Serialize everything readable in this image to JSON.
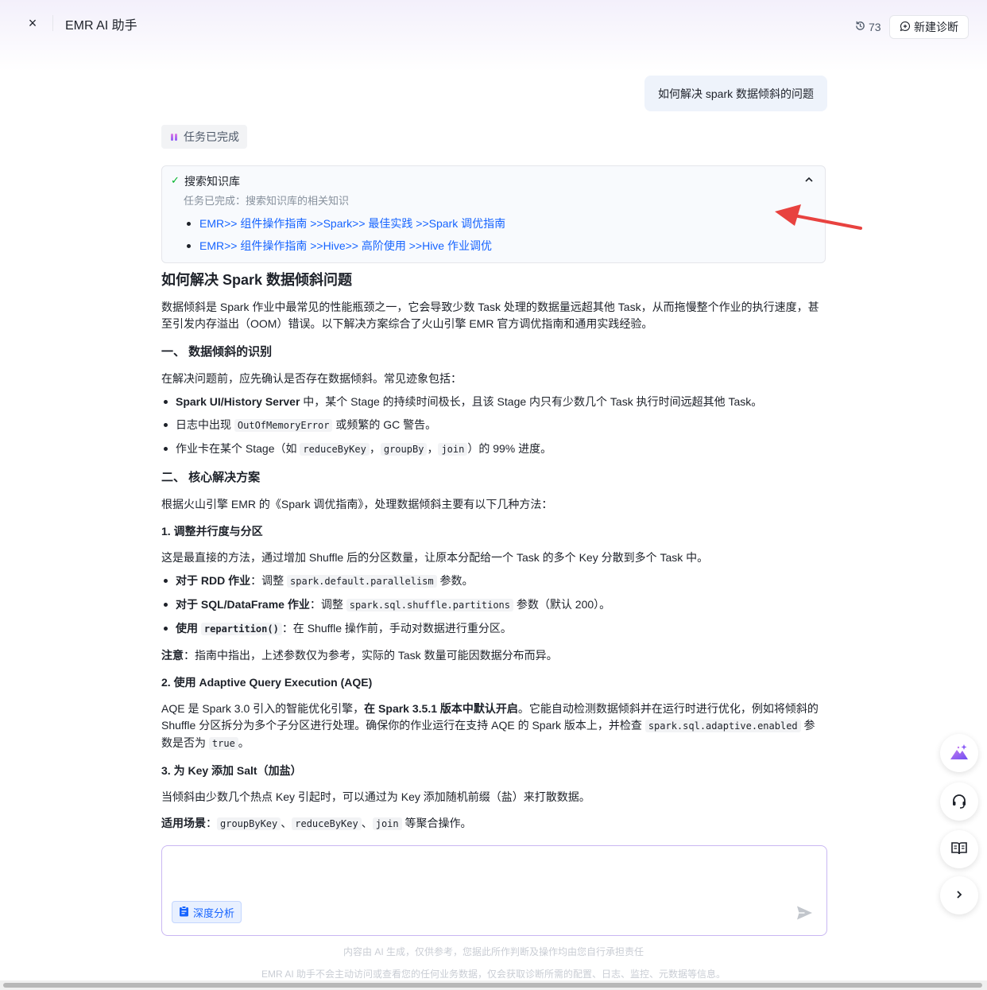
{
  "header": {
    "close_label": "×",
    "title": "EMR AI 助手",
    "history_count": "73",
    "new_button_label": "新建诊断"
  },
  "user_message": "如何解决 spark 数据倾斜的问题",
  "status_chip": "任务已完成",
  "knowledge_panel": {
    "title": "搜索知识库",
    "subtitle": "任务已完成：搜索知识库的相关知识",
    "links": [
      "EMR>> 组件操作指南 >>Spark>> 最佳实践 >>Spark 调优指南",
      "EMR>> 组件操作指南 >>Hive>> 高阶使用 >>Hive 作业调优"
    ]
  },
  "article": {
    "title": "如何解决 Spark 数据倾斜问题",
    "intro": "数据倾斜是 Spark 作业中最常见的性能瓶颈之一，它会导致少数 Task 处理的数据量远超其他 Task，从而拖慢整个作业的执行速度，甚至引发内存溢出（OOM）错误。以下解决方案综合了火山引擎 EMR 官方调优指南和通用实践经验。",
    "s1_heading": "一、 数据倾斜的识别",
    "s1_para": "在解决问题前，应先确认是否存在数据倾斜。常见迹象包括：",
    "s1_b1_bold": "Spark UI/History Server",
    "s1_b1_text": " 中，某个 Stage 的持续时间极长，且该 Stage 内只有少数几个 Task 执行时间远超其他 Task。",
    "s1_b2_pre": "日志中出现 ",
    "s1_b2_code": "OutOfMemoryError",
    "s1_b2_post": " 或频繁的 GC 警告。",
    "s1_b3_pre": "作业卡在某个 Stage（如 ",
    "s1_b3_code1": "reduceByKey",
    "s1_b3_sep1": "，",
    "s1_b3_code2": "groupBy",
    "s1_b3_sep2": "，",
    "s1_b3_code3": "join",
    "s1_b3_post": "）的 99% 进度。",
    "s2_heading": "二、 核心解决方案",
    "s2_para": "根据火山引擎 EMR 的《Spark 调优指南》，处理数据倾斜主要有以下几种方法：",
    "m1_heading": "1. 调整并行度与分区",
    "m1_para": "这是最直接的方法，通过增加 Shuffle 后的分区数量，让原本分配给一个 Task 的多个 Key 分散到多个 Task 中。",
    "m1_b1_bold": "对于 RDD 作业",
    "m1_b1_pre": "：调整 ",
    "m1_b1_code": "spark.default.parallelism",
    "m1_b1_post": " 参数。",
    "m1_b2_bold": "对于 SQL/DataFrame 作业",
    "m1_b2_pre": "：调整 ",
    "m1_b2_code": "spark.sql.shuffle.partitions",
    "m1_b2_post": " 参数（默认 200）。",
    "m1_b3_bold": "使用 ",
    "m1_b3_code": "repartition()",
    "m1_b3_post": "：在 Shuffle 操作前，手动对数据进行重分区。",
    "note_bold": "注意",
    "note_text": "：指南中指出，上述参数仅为参考，实际的 Task 数量可能因数据分布而异。",
    "m2_heading": "2. 使用 Adaptive Query Execution (AQE)",
    "m2_pre": "AQE 是 Spark 3.0 引入的智能优化引擎，",
    "m2_bold": "在 Spark 3.5.1 版本中默认开启",
    "m2_mid": "。它能自动检测数据倾斜并在运行时进行优化，例如将倾斜的 Shuffle 分区拆分为多个子分区进行处理。确保你的作业运行在支持 AQE 的 Spark 版本上，并检查 ",
    "m2_code1": "spark.sql.adaptive.enabled",
    "m2_mid2": " 参数是否为 ",
    "m2_code2": "true",
    "m2_post": "。",
    "m3_heading": "3. 为 Key 添加 Salt（加盐）",
    "m3_para": "当倾斜由少数几个热点 Key 引起时，可以通过为 Key 添加随机前缀（盐）来打散数据。",
    "m3_use_bold": "适用场景",
    "m3_use_pre": "：",
    "m3_use_code1": "groupByKey",
    "m3_use_sep1": "、",
    "m3_use_code2": "reduceByKey",
    "m3_use_sep2": "、",
    "m3_use_code3": "join",
    "m3_use_post": " 等聚合操作。"
  },
  "composer": {
    "deep_analysis_label": "深度分析"
  },
  "disclaimer_1": "内容由 AI 生成，仅供参考，您据此所作判断及操作均由您自行承担责任",
  "disclaimer_2": "EMR AI 助手不会主动访问或查看您的任何业务数据，仅会获取诊断所需的配置、日志、监控、元数据等信息。",
  "colors": {
    "link": "#1664ff",
    "accent_purple": "#8a5cf6",
    "annotation_arrow": "#e8423f"
  }
}
